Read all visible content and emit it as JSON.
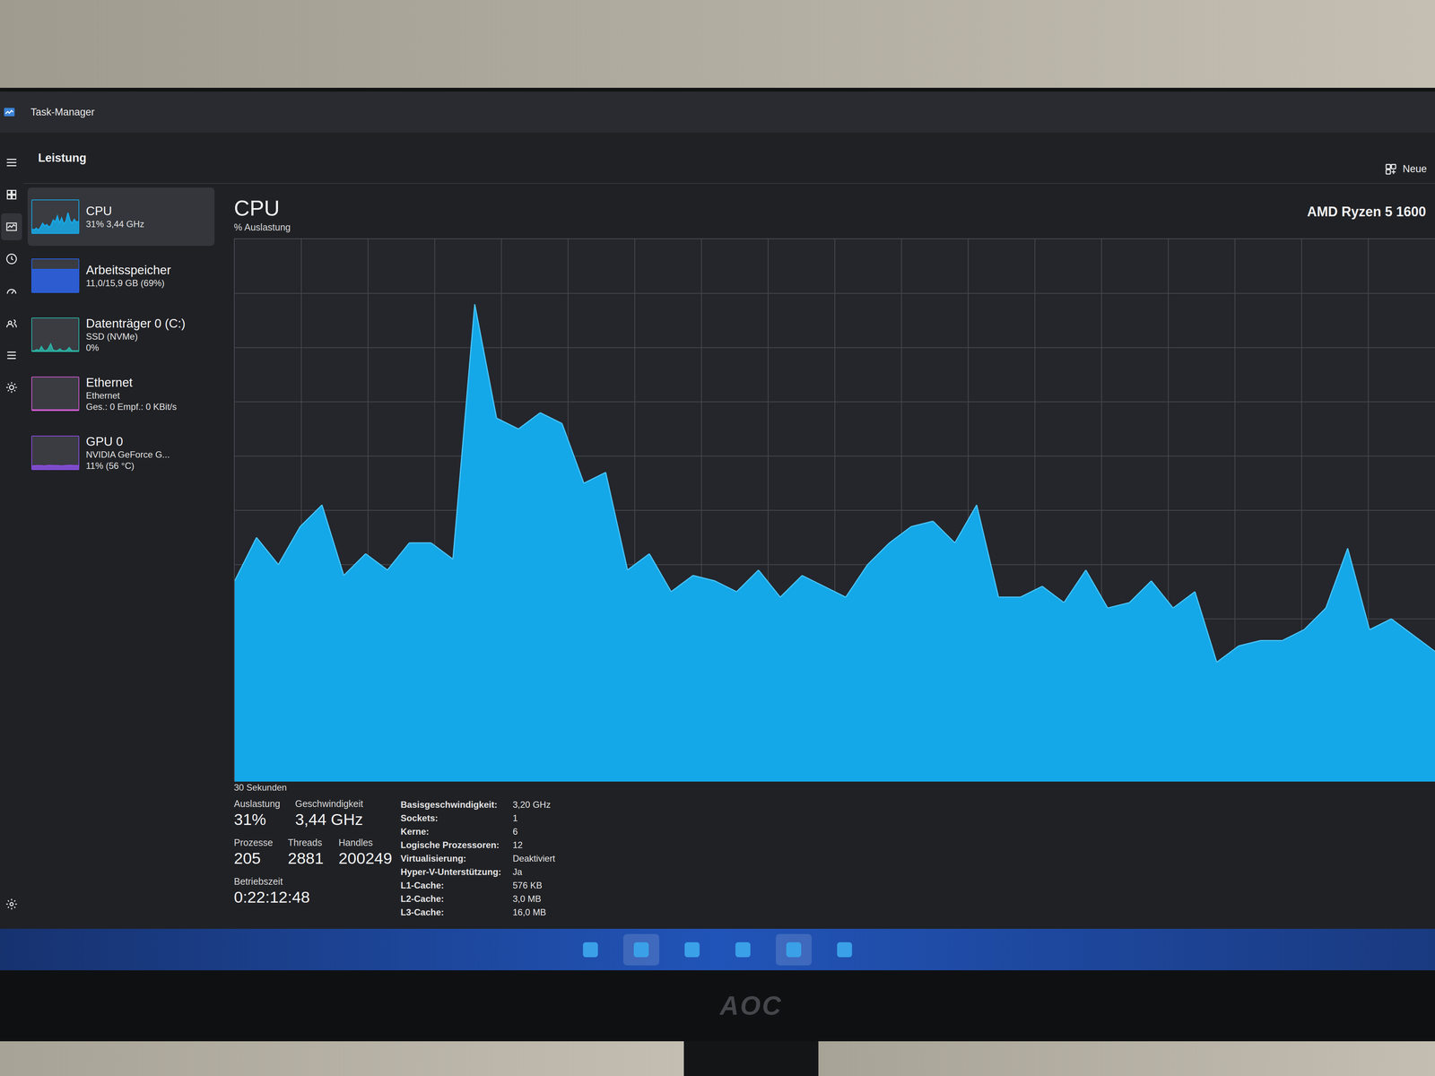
{
  "window": {
    "title": "Task-Manager"
  },
  "nav": {
    "items": [
      {
        "selected": false
      },
      {
        "selected": true
      },
      {
        "selected": false
      },
      {
        "selected": false
      },
      {
        "selected": false
      },
      {
        "selected": false
      },
      {
        "selected": false
      }
    ]
  },
  "page": {
    "title": "Leistung",
    "action": "Neue"
  },
  "sidebar": {
    "items": [
      {
        "title": "CPU",
        "lines": [
          "31% 3,44 GHz"
        ],
        "selected": true,
        "color": "#17a9e8",
        "graph": [
          12,
          10,
          15,
          9,
          18,
          30,
          22,
          26,
          18,
          24,
          40,
          34,
          52,
          30,
          46,
          28,
          36,
          62,
          38,
          30,
          42,
          33,
          36
        ]
      },
      {
        "title": "Arbeitsspeicher",
        "lines": [
          "11,0/15,9 GB (69%)"
        ],
        "selected": false,
        "color": "#2a62e8",
        "graph": [
          69,
          69,
          69,
          69,
          69,
          69,
          69,
          69,
          69,
          69,
          69,
          69
        ]
      },
      {
        "title": "Datenträger 0 (C:)",
        "lines": [
          "SSD (NVMe)",
          "0%"
        ],
        "selected": false,
        "color": "#2bb3a4",
        "graph": [
          0,
          0,
          5,
          0,
          14,
          3,
          0,
          8,
          22,
          4,
          0,
          2,
          7,
          0,
          0,
          3,
          11,
          2,
          0,
          0,
          0
        ]
      },
      {
        "title": "Ethernet",
        "lines": [
          "Ethernet",
          "Ges.: 0 Empf.: 0 KBit/s"
        ],
        "selected": false,
        "color": "#d05ad0",
        "graph": [
          0,
          0,
          0,
          0,
          0,
          0,
          0,
          0,
          0,
          0
        ]
      },
      {
        "title": "GPU 0",
        "lines": [
          "NVIDIA GeForce G...",
          "11% (56 °C)"
        ],
        "selected": false,
        "color": "#8a4de0",
        "graph": [
          10,
          11,
          11,
          10,
          12,
          11,
          11,
          10,
          11,
          12,
          11,
          11
        ]
      }
    ]
  },
  "panel": {
    "title": "CPU",
    "model": "AMD Ryzen 5 1600",
    "y_label": "% Auslastung",
    "x_label": "30 Sekunden"
  },
  "chart": {
    "values": [
      37,
      45,
      40,
      47,
      51,
      38,
      42,
      39,
      44,
      44,
      41,
      88,
      67,
      65,
      68,
      66,
      55,
      57,
      39,
      42,
      35,
      38,
      37,
      35,
      39,
      34,
      38,
      36,
      34,
      40,
      44,
      47,
      48,
      44,
      51,
      34,
      34,
      36,
      33,
      39,
      32,
      33,
      37,
      32,
      35,
      22,
      25,
      26,
      26,
      28,
      32,
      43,
      28,
      30,
      27,
      24
    ]
  },
  "stats": [
    [
      {
        "label": "Auslastung",
        "value": "31%"
      },
      {
        "label": "Geschwindigkeit",
        "value": "3,44 GHz"
      }
    ],
    [
      {
        "label": "Prozesse",
        "value": "205"
      },
      {
        "label": "Threads",
        "value": "2881"
      },
      {
        "label": "Handles",
        "value": "200249"
      }
    ],
    [
      {
        "label": "Betriebszeit",
        "value": "0:22:12:48"
      }
    ]
  ],
  "details": [
    {
      "label": "Basisgeschwindigkeit:",
      "value": "3,20 GHz"
    },
    {
      "label": "Sockets:",
      "value": "1"
    },
    {
      "label": "Kerne:",
      "value": "6"
    },
    {
      "label": "Logische Prozessoren:",
      "value": "12"
    },
    {
      "label": "Virtualisierung:",
      "value": "Deaktiviert"
    },
    {
      "label": "Hyper-V-Unterstützung:",
      "value": "Ja"
    },
    {
      "label": "L1-Cache:",
      "value": "576 KB"
    },
    {
      "label": "L2-Cache:",
      "value": "3,0 MB"
    },
    {
      "label": "L3-Cache:",
      "value": "16,0 MB"
    }
  ],
  "taskbar": {
    "apps": [
      {
        "active": false
      },
      {
        "active": true
      },
      {
        "active": false
      },
      {
        "active": false
      },
      {
        "active": true
      },
      {
        "active": false
      }
    ]
  },
  "monitor": {
    "brand": "AOC"
  }
}
